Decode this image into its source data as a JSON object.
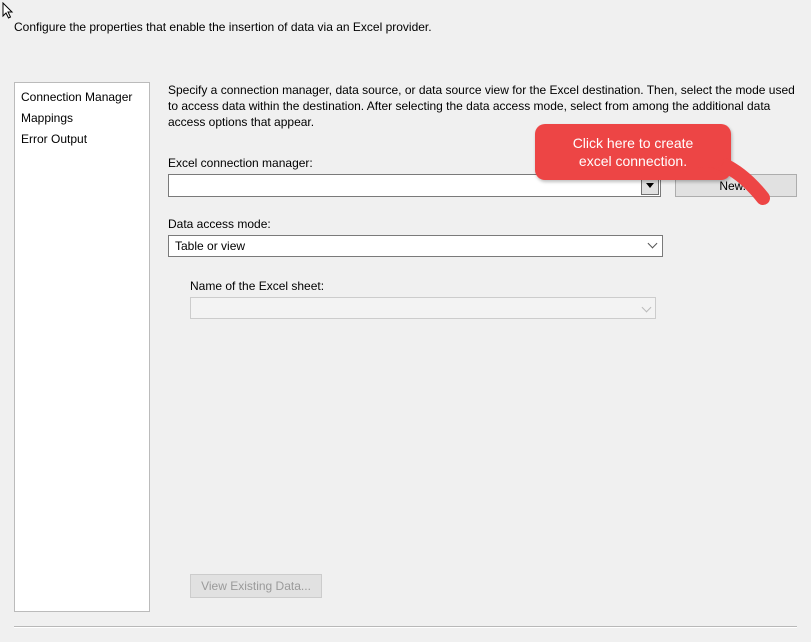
{
  "top_description": "Configure the properties that enable the insertion of data via an Excel provider.",
  "sidebar": {
    "items": [
      {
        "label": "Connection Manager"
      },
      {
        "label": "Mappings"
      },
      {
        "label": "Error Output"
      }
    ]
  },
  "right": {
    "intro": "Specify a connection manager, data source, or data source view for the Excel destination. Then, select the mode used to access data within the destination. After selecting the data access mode, select from among the additional data access options that appear.",
    "cm_label": "Excel connection manager:",
    "cm_value": "",
    "new_button": "New...",
    "mode_label": "Data access mode:",
    "mode_value": "Table or view",
    "sheet_label": "Name of the Excel sheet:",
    "sheet_value": "",
    "view_button": "View Existing Data..."
  },
  "callout": {
    "line1": "Click here to create",
    "line2": "excel connection."
  }
}
